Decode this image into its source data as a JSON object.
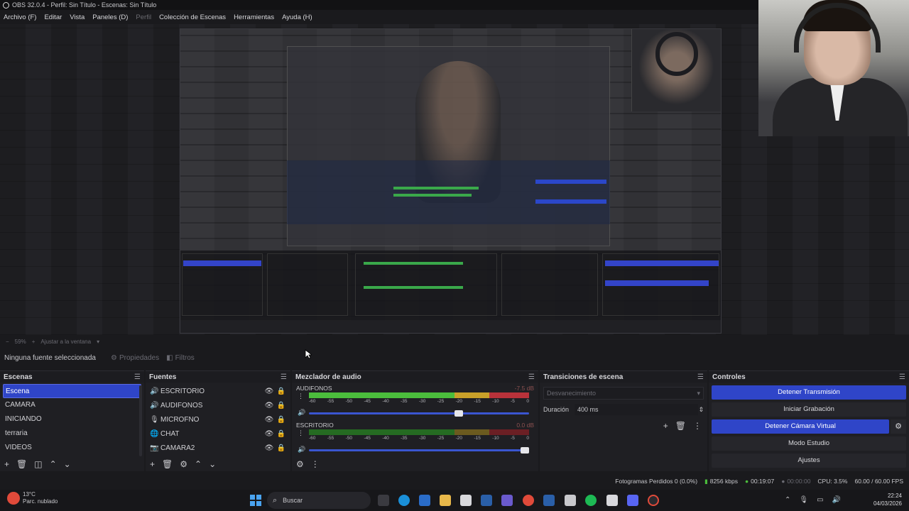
{
  "window": {
    "title": "OBS 32.0.4 - Perfil: Sin Título - Escenas: Sin Título"
  },
  "menu": [
    {
      "label": "Archivo (F)",
      "dim": false
    },
    {
      "label": "Editar",
      "dim": false
    },
    {
      "label": "Vista",
      "dim": false
    },
    {
      "label": "Paneles (D)",
      "dim": false
    },
    {
      "label": "Perfil",
      "dim": true
    },
    {
      "label": "Colección de Escenas",
      "dim": false
    },
    {
      "label": "Herramientas",
      "dim": false
    },
    {
      "label": "Ayuda (H)",
      "dim": false
    }
  ],
  "zoom": {
    "percent": "59%",
    "fit_label": "Ajustar a la ventana"
  },
  "context": {
    "no_source": "Ninguna fuente seleccionada",
    "properties": "Propiedades",
    "filters": "Filtros"
  },
  "scenes": {
    "title": "Escenas",
    "items": [
      "Escena",
      "CAMARA",
      "INICIANDO",
      "terraria",
      "VIDEOS"
    ],
    "active_index": 0
  },
  "sources": {
    "title": "Fuentes",
    "items": [
      {
        "name": "ESCRITORIO",
        "icon": "speaker-icon"
      },
      {
        "name": "AUDIFONOS",
        "icon": "speaker-icon"
      },
      {
        "name": "MICROFNO",
        "icon": "microphone-icon"
      },
      {
        "name": "CHAT",
        "icon": "browser-icon"
      },
      {
        "name": "CAMARA2",
        "icon": "camera-icon"
      }
    ]
  },
  "mixer": {
    "title": "Mezclador de audio",
    "ticks": [
      "-60",
      "-55",
      "-50",
      "-45",
      "-40",
      "-35",
      "-30",
      "-25",
      "-20",
      "-15",
      "-10",
      "-5",
      "0"
    ],
    "channels": [
      {
        "name": "AUDIFONOS",
        "db": "-7.5 dB",
        "level": 0.88,
        "volume": 0.7
      },
      {
        "name": "ESCRITORIO",
        "db": "0.0 dB",
        "level": 1.0,
        "volume": 1.0
      }
    ]
  },
  "transitions": {
    "title": "Transiciones de escena",
    "selected": "Desvanecimiento",
    "duration_label": "Duración",
    "duration_value": "400 ms"
  },
  "controls": {
    "title": "Controles",
    "stop_stream": "Detener Transmisión",
    "start_recording": "Iniciar Grabación",
    "stop_virtual_cam": "Detener Cámara Virtual",
    "studio_mode": "Modo Estudio",
    "settings": "Ajustes"
  },
  "status": {
    "dropped_frames": "Fotogramas Perdidos 0 (0.0%)",
    "bitrate": "8256 kbps",
    "stream_time": "00:19:07",
    "record_time": "00:00:00",
    "cpu": "CPU: 3.5%",
    "fps": "60.00 / 60.00 FPS"
  },
  "taskbar": {
    "weather_temp": "13°C",
    "weather_desc": "Parc. nublado",
    "search": "Buscar",
    "time": "22:24",
    "date": "04/03/2026"
  },
  "colors": {
    "accent": "#2f45c8",
    "meter_green": "#4bbd3c",
    "meter_yellow": "#c9a029",
    "meter_red": "#b8323a"
  }
}
